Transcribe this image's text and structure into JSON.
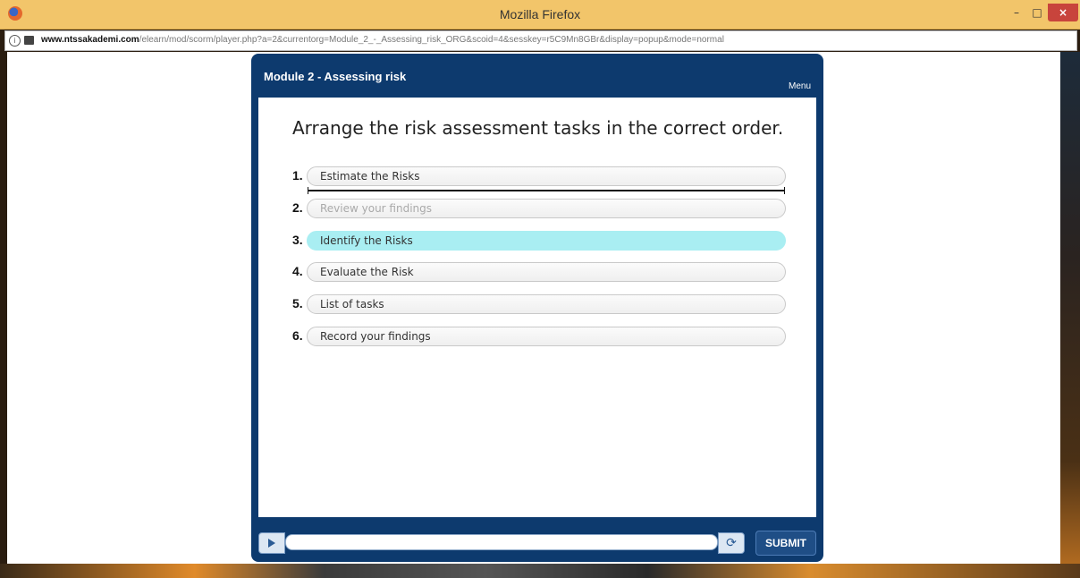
{
  "browser": {
    "window_title": "Mozilla Firefox",
    "url_domain": "www.ntssakademi.com",
    "url_path": "/elearn/mod/scorm/player.php?a=2&currentorg=Module_2_-_Assessing_risk_ORG&scoid=4&sesskey=r5C9Mn8GBr&display=popup&mode=normal",
    "controls": {
      "minimize": "–",
      "maximize": "□",
      "close": "×"
    }
  },
  "player": {
    "module_title": "Module 2 - Assessing risk",
    "menu_label": "Menu",
    "question": "Arrange the risk assessment tasks in the correct order.",
    "items": [
      {
        "number": "1.",
        "label": "Estimate the Risks"
      },
      {
        "number": "2.",
        "label": "Review your findings"
      },
      {
        "number": "3.",
        "label": "Identify the Risks"
      },
      {
        "number": "4.",
        "label": "Evaluate the Risk"
      },
      {
        "number": "5.",
        "label": "List of tasks"
      },
      {
        "number": "6.",
        "label": "Record your findings"
      }
    ],
    "active_item_color": "#a9eef2",
    "submit_label": "SUBMIT",
    "icons": {
      "play": "play-icon",
      "reload": "reload-icon",
      "info": "info-icon"
    }
  }
}
